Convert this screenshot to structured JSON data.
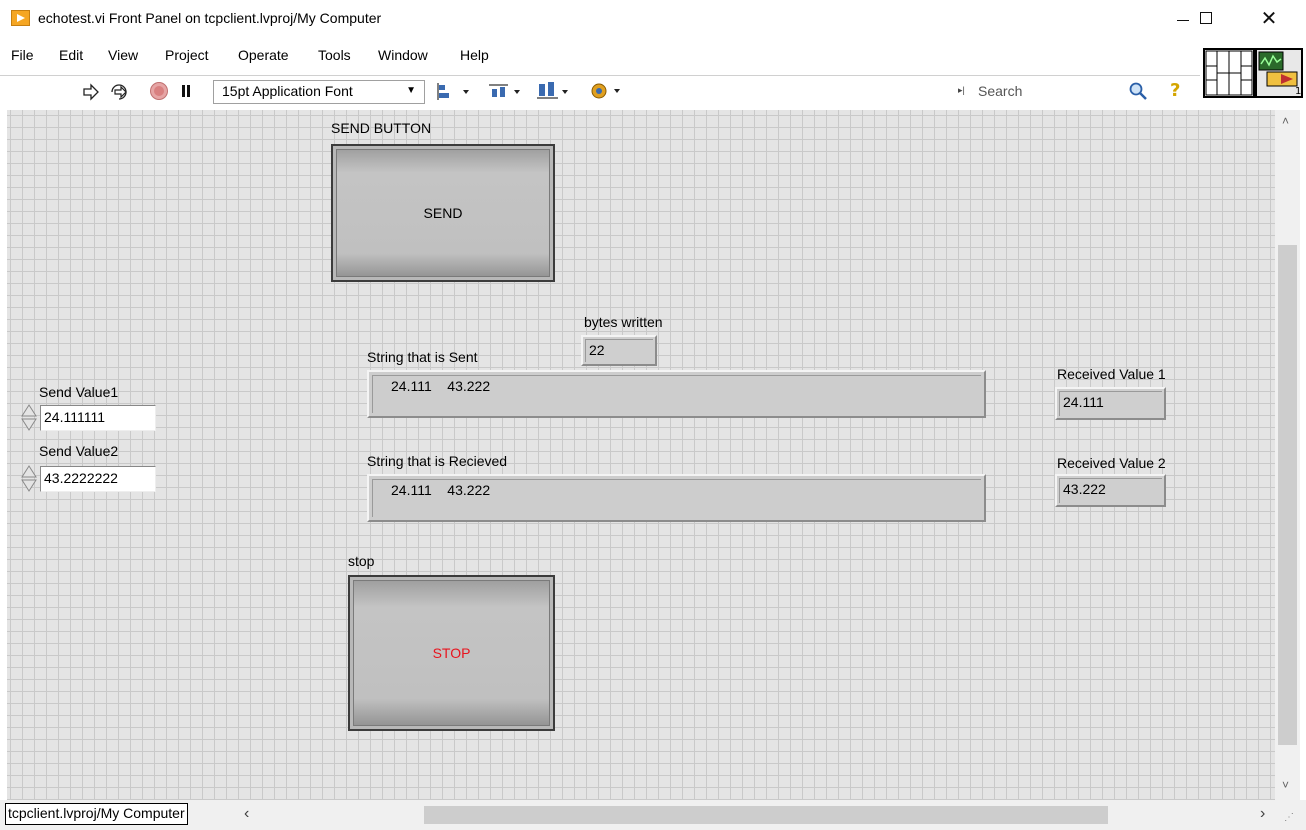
{
  "window": {
    "title": "echotest.vi Front Panel on tcpclient.lvproj/My Computer",
    "min_glyph": "—",
    "max_glyph": "☐",
    "close_glyph": "✕"
  },
  "menu": {
    "items": [
      "File",
      "Edit",
      "View",
      "Project",
      "Operate",
      "Tools",
      "Window",
      "Help"
    ]
  },
  "toolbar": {
    "font": "15pt Application Font",
    "search_placeholder": "Search",
    "help_glyph": "?"
  },
  "panel": {
    "send_button_label": "SEND BUTTON",
    "send_button_text": "SEND",
    "bytes_written_label": "bytes written",
    "bytes_written_value": "22",
    "string_sent_label": "String that is Sent",
    "string_sent_value": "24.111    43.222",
    "string_received_label": "String that is Recieved",
    "string_received_value": "24.111    43.222",
    "send_value1_label": "Send Value1",
    "send_value1": "24.111111",
    "send_value2_label": "Send Value2",
    "send_value2": "43.2222222",
    "received_value1_label": "Received Value 1",
    "received_value1": "24.111",
    "received_value2_label": "Received Value 2",
    "received_value2": "43.222",
    "stop_label": "stop",
    "stop_text": "STOP",
    "stop_text_color": "#e8141e"
  },
  "status": {
    "context": "tcpclient.lvproj/My Computer"
  }
}
